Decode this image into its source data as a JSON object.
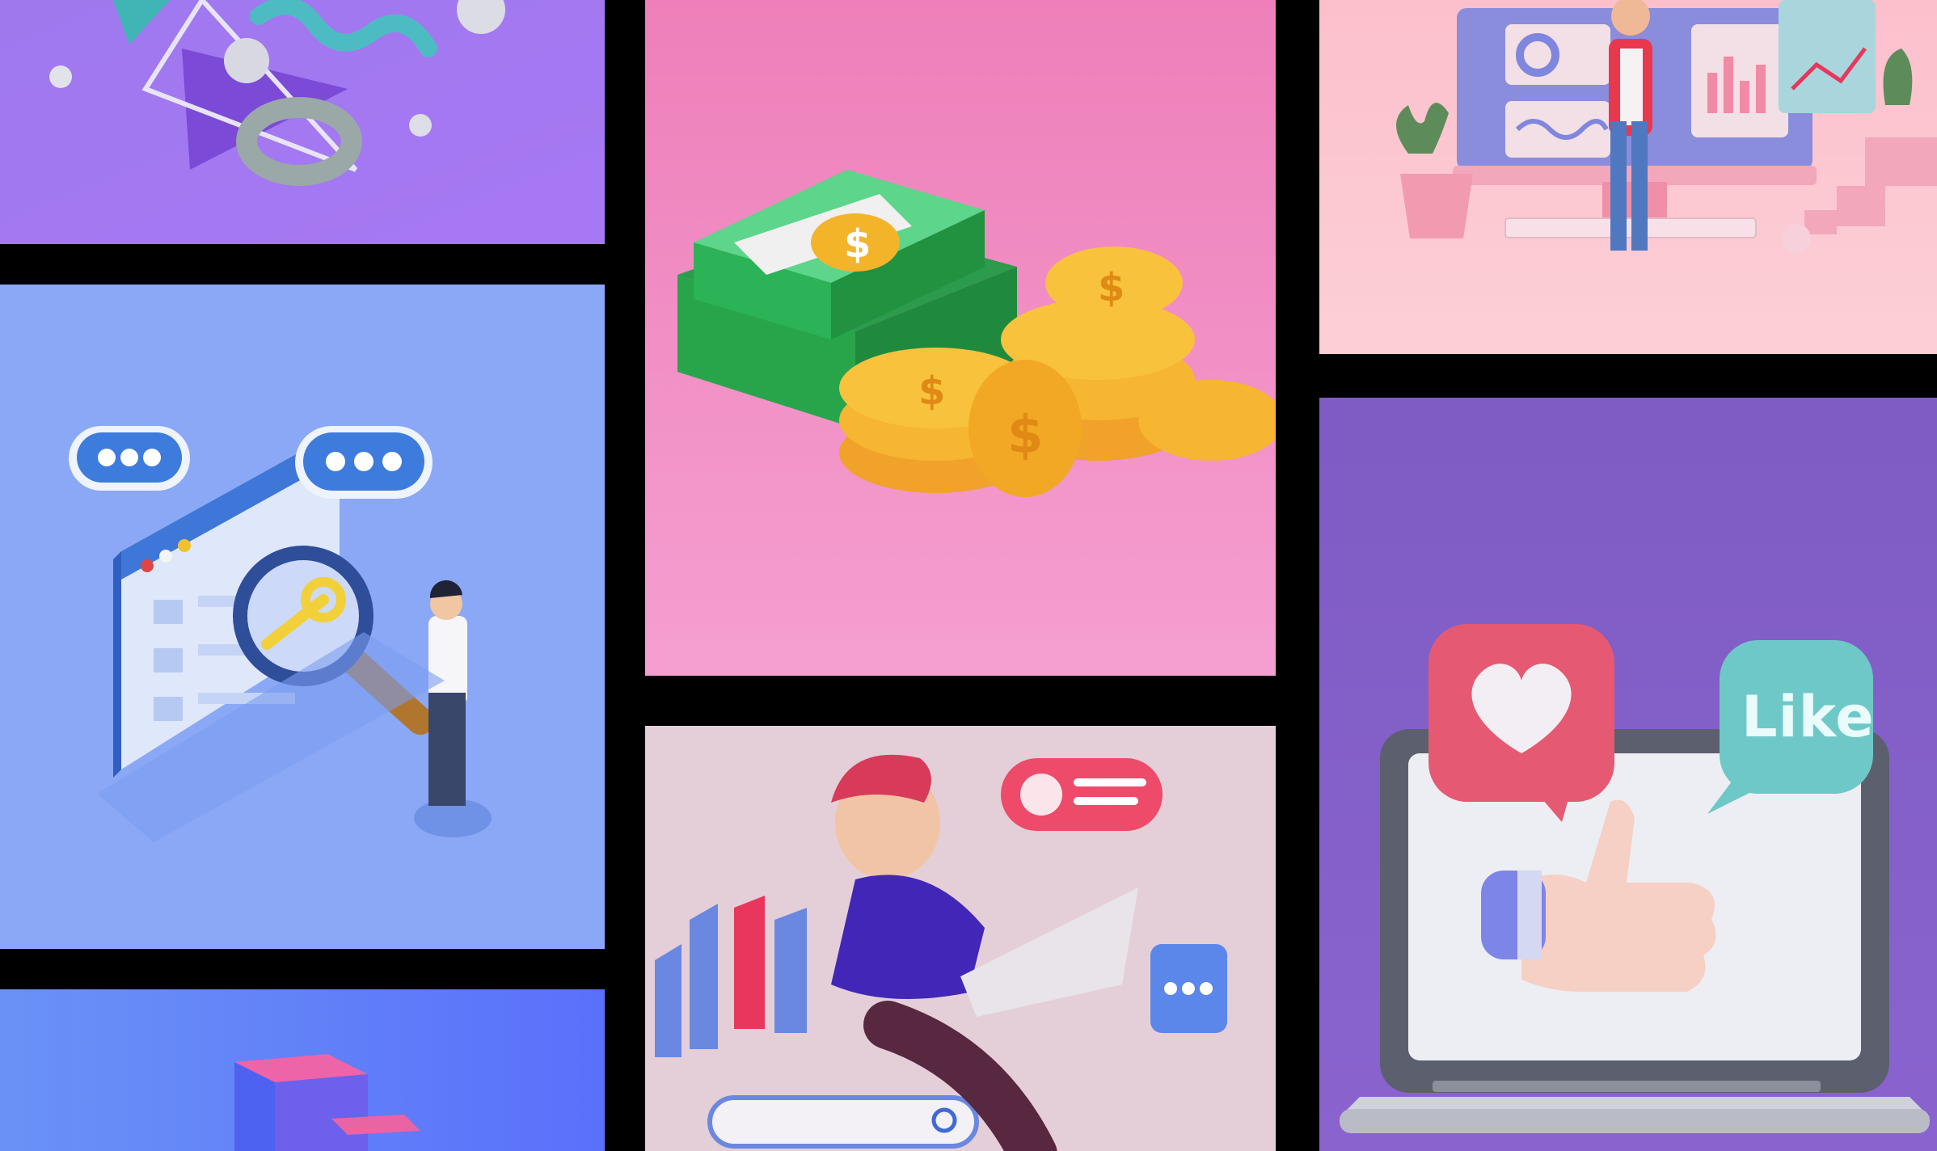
{
  "gallery": {
    "tiles": [
      {
        "icon": "abstract-shapes-icon",
        "background": "#9b74ee"
      },
      {
        "icon": "search-key-icon",
        "background": "#8aa8f6"
      },
      {
        "icon": "gradient-blocks-icon",
        "background": "#5f7cfb"
      },
      {
        "icon": "money-stack-icon",
        "background": "#f48fc4"
      },
      {
        "icon": "laptop-user-icon",
        "background": "#e4cfd8"
      },
      {
        "icon": "dashboard-person-icon",
        "background": "#fbc5cf"
      },
      {
        "icon": "social-like-icon",
        "background": "#7f5fc4",
        "like_label": "Like"
      }
    ]
  }
}
